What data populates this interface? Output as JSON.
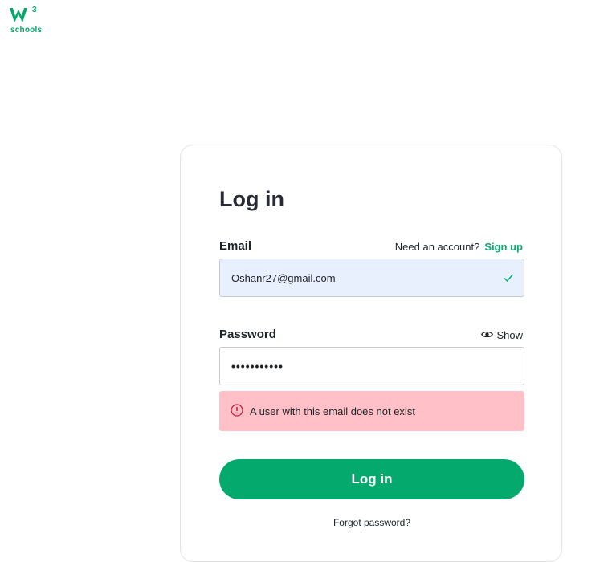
{
  "brand": {
    "logo_text": "schools",
    "logo_superscript": "3",
    "color": "#04aa6d"
  },
  "form": {
    "title": "Log in",
    "email_label": "Email",
    "need_account_text": "Need an account?",
    "signup_label": "Sign up",
    "email_value": "Oshanr27@gmail.com",
    "password_label": "Password",
    "show_label": "Show",
    "password_value": "•••••••••••",
    "error_message": "A user with this email does not exist",
    "login_button_label": "Log in",
    "forgot_password_label": "Forgot password?"
  },
  "colors": {
    "accent": "#04aa6d",
    "email_field_bg": "#e8f0fe",
    "error_bg": "#ffc0c7",
    "error_icon": "#c41e3a"
  },
  "icons": {
    "email_valid": "check-icon",
    "show_password": "eye-icon",
    "error": "alert-circle-icon"
  }
}
